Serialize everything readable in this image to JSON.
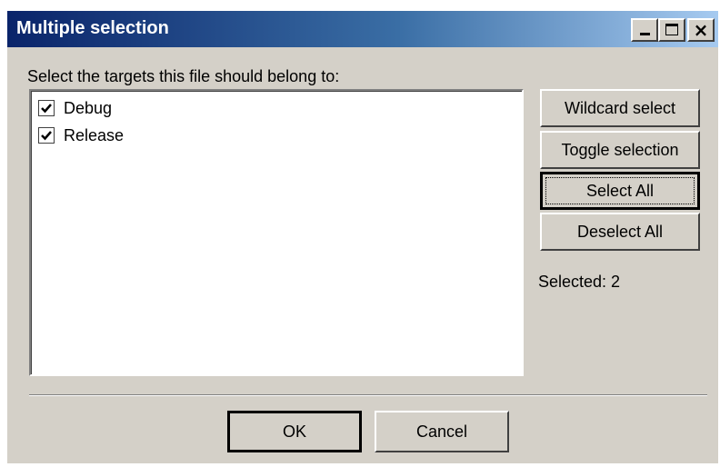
{
  "window": {
    "title": "Multiple selection",
    "controls": {
      "minimize": "_",
      "maximize": "□",
      "close": "×"
    }
  },
  "instruction": "Select the targets this file should belong to:",
  "targets": [
    {
      "label": "Debug",
      "checked": true
    },
    {
      "label": "Release",
      "checked": true
    }
  ],
  "side_buttons": {
    "wildcard": "Wildcard select",
    "toggle": "Toggle selection",
    "select_all": "Select All",
    "deselect_all": "Deselect All"
  },
  "status": "Selected: 2",
  "dialog_buttons": {
    "ok": "OK",
    "cancel": "Cancel"
  },
  "colors": {
    "face": "#d4d0c8",
    "title_start": "#0a246a",
    "title_end": "#a6caf0"
  }
}
